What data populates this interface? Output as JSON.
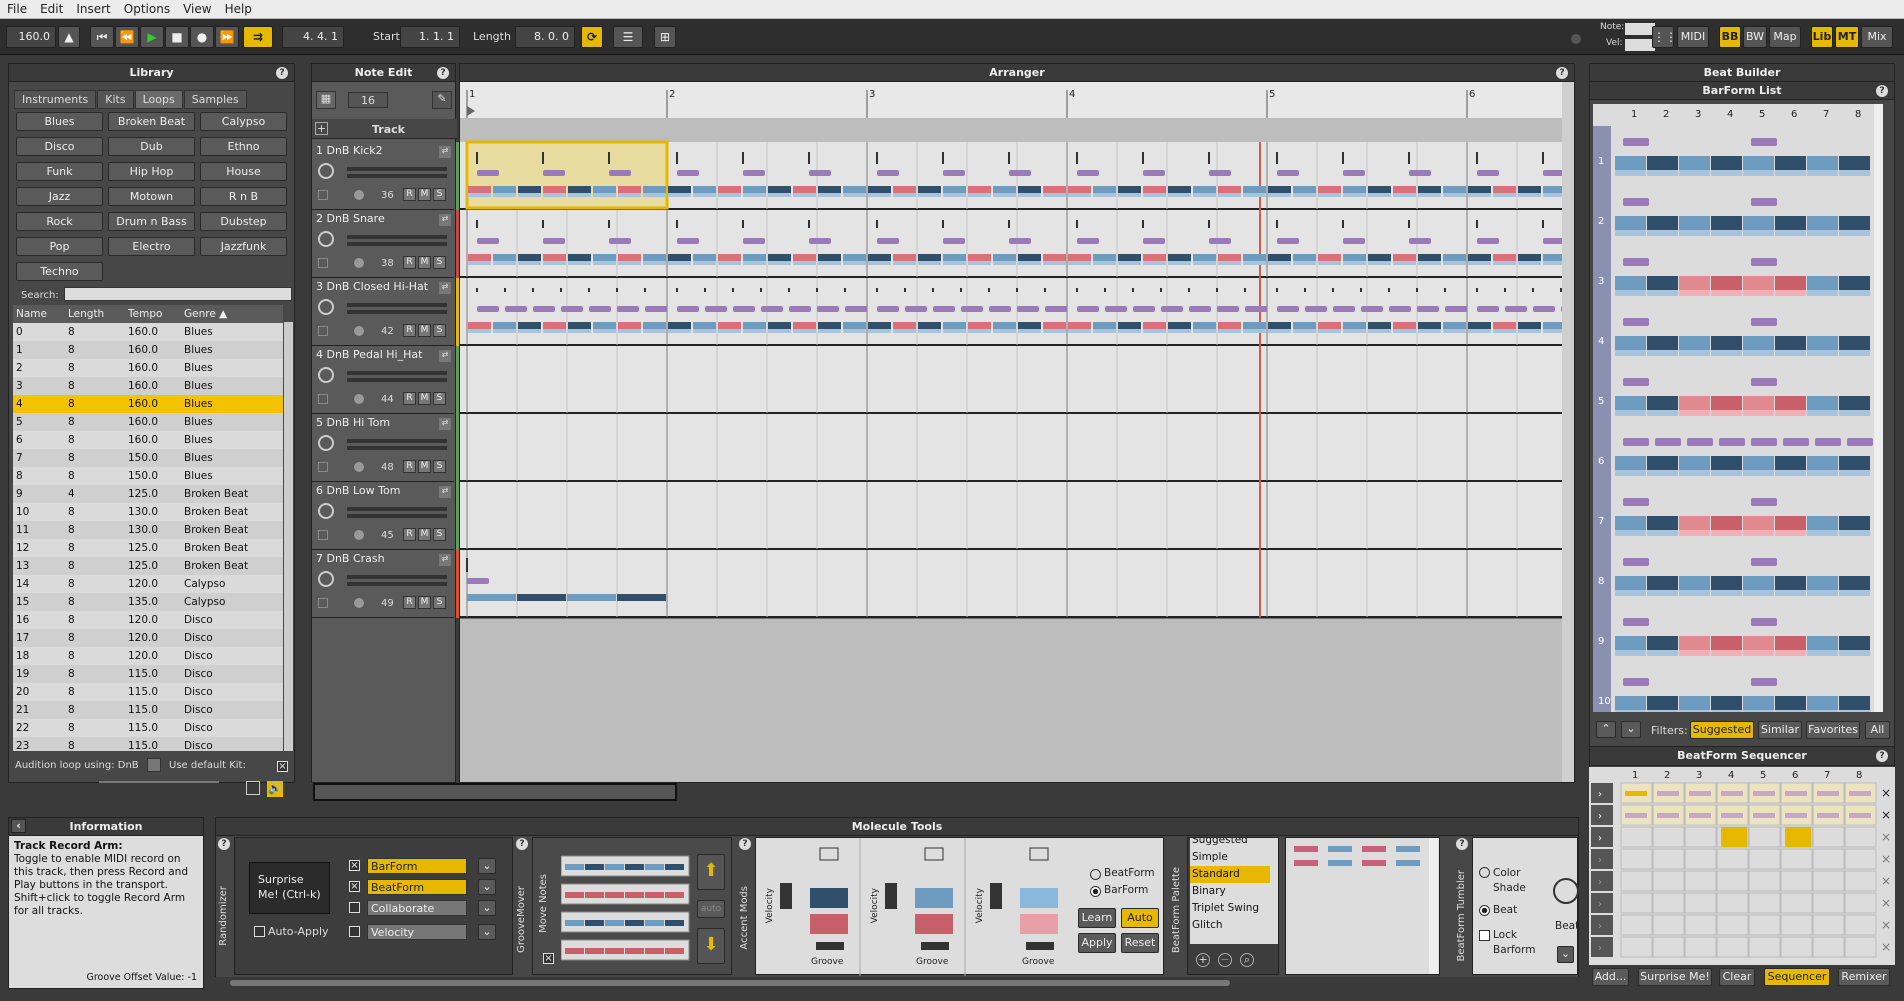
{
  "menu": [
    "File",
    "Edit",
    "Insert",
    "Options",
    "View",
    "Help"
  ],
  "transport": {
    "tempo": "160.0",
    "position": "4. 4. 1",
    "start_label": "Start",
    "start_value": "1. 1. 1",
    "length_label": "Length",
    "length_value": "8. 0. 0",
    "note_label": "Note:",
    "vel_label": "Vel:",
    "midi": "MIDI",
    "toggles": [
      "BB",
      "BW",
      "Map",
      "Lib",
      "MT",
      "Mix"
    ]
  },
  "library": {
    "title": "Library",
    "tabs": [
      "Instruments",
      "Kits",
      "Loops",
      "Samples"
    ],
    "genres": [
      "Blues",
      "Broken Beat",
      "Calypso",
      "Disco",
      "Dub",
      "Ethno",
      "Funk",
      "Hip Hop",
      "House",
      "Jazz",
      "Motown",
      "R n B",
      "Rock",
      "Drum n Bass",
      "Dubstep",
      "Pop",
      "Electro",
      "Jazzfunk",
      "Techno"
    ],
    "search_label": "Search:",
    "columns": [
      "Name",
      "Length",
      "Tempo",
      "Genre ▲"
    ],
    "rows": [
      [
        "0",
        "8",
        "160.0",
        "Blues"
      ],
      [
        "1",
        "8",
        "160.0",
        "Blues"
      ],
      [
        "2",
        "8",
        "160.0",
        "Blues"
      ],
      [
        "3",
        "8",
        "160.0",
        "Blues"
      ],
      [
        "4",
        "8",
        "160.0",
        "Blues"
      ],
      [
        "5",
        "8",
        "160.0",
        "Blues"
      ],
      [
        "6",
        "8",
        "160.0",
        "Blues"
      ],
      [
        "7",
        "8",
        "150.0",
        "Blues"
      ],
      [
        "8",
        "8",
        "150.0",
        "Blues"
      ],
      [
        "9",
        "4",
        "125.0",
        "Broken Beat"
      ],
      [
        "10",
        "8",
        "130.0",
        "Broken Beat"
      ],
      [
        "11",
        "8",
        "130.0",
        "Broken Beat"
      ],
      [
        "12",
        "8",
        "125.0",
        "Broken Beat"
      ],
      [
        "13",
        "8",
        "125.0",
        "Broken Beat"
      ],
      [
        "14",
        "8",
        "120.0",
        "Calypso"
      ],
      [
        "15",
        "8",
        "135.0",
        "Calypso"
      ],
      [
        "16",
        "8",
        "120.0",
        "Disco"
      ],
      [
        "17",
        "8",
        "120.0",
        "Disco"
      ],
      [
        "18",
        "8",
        "120.0",
        "Disco"
      ],
      [
        "19",
        "8",
        "115.0",
        "Disco"
      ],
      [
        "20",
        "8",
        "115.0",
        "Disco"
      ],
      [
        "21",
        "8",
        "115.0",
        "Disco"
      ],
      [
        "22",
        "8",
        "115.0",
        "Disco"
      ],
      [
        "23",
        "8",
        "115.0",
        "Disco"
      ]
    ],
    "audition_label": "Audition loop using: DnB",
    "default_kit_label": "Use default Kit:"
  },
  "noteedit": {
    "title": "Note Edit",
    "grid": "16",
    "track_header": "Track"
  },
  "arranger": {
    "title": "Arranger",
    "bars": [
      "1",
      "2",
      "3",
      "4",
      "5",
      "6"
    ]
  },
  "tracks": [
    {
      "name": "1 DnB Kick2",
      "num": "36"
    },
    {
      "name": "2 DnB Snare",
      "num": "38"
    },
    {
      "name": "3 DnB Closed Hi-Hat",
      "num": "42"
    },
    {
      "name": "4 DnB Pedal Hi_Hat",
      "num": "44"
    },
    {
      "name": "5 DnB Hi Tom",
      "num": "48"
    },
    {
      "name": "6 DnB Low Tom",
      "num": "45"
    },
    {
      "name": "7 DnB Crash",
      "num": "49"
    }
  ],
  "track_btns": [
    "R",
    "M",
    "S"
  ],
  "beatbuilder": {
    "title": "Beat Builder",
    "barform_list": "BarForm List",
    "cols": [
      "1",
      "2",
      "3",
      "4",
      "5",
      "6",
      "7",
      "8"
    ],
    "rows": [
      "1",
      "2",
      "3",
      "4",
      "5",
      "6",
      "7",
      "8",
      "9",
      "10"
    ],
    "filters_label": "Filters:",
    "filters": [
      "Suggested",
      "Similar",
      "Favorites",
      "All"
    ],
    "sequencer_title": "BeatForm Sequencer",
    "bottom": [
      "Add...",
      "Surprise Me!",
      "Clear",
      "Sequencer",
      "Remixer"
    ]
  },
  "info": {
    "title": "Information",
    "heading": "Track Record Arm:",
    "body": "Toggle to enable MIDI record on this track, then press Record and Play buttons in the transport. Shift+click to toggle Record Arm for all tracks.",
    "groove_offset": "Groove Offset Value: -1"
  },
  "molecule": {
    "title": "Molecule Tools",
    "randomizer": "Randomizer",
    "surprise": "Surprise Me! (Ctrl-k)",
    "auto_apply": "Auto-Apply",
    "options": [
      "BarForm",
      "BeatForm",
      "Collaborate",
      "Velocity"
    ],
    "groovemover": "GrooveMover",
    "move_notes": "Move Notes",
    "auto": "auto",
    "accent_mods": "Accent Mods",
    "velocity": "Velocity",
    "groove": "Groove",
    "radio": [
      "BeatForm",
      "BarForm"
    ],
    "learn": "Learn",
    "auto_btn": "Auto",
    "apply": "Apply",
    "reset": "Reset",
    "palette_title": "BeatForm Palette",
    "palette_items": [
      "Suggested",
      "Simple",
      "Standard",
      "Binary",
      "Triplet Swing",
      "Glitch"
    ],
    "tumbler_title": "BeatForm Tumbler",
    "tumbler_opts": [
      "Color Shade",
      "Beat",
      "Lock Barform"
    ],
    "beat": "Beat"
  },
  "colors": {
    "accent": "#e6b800",
    "blue": "#6d9cc0",
    "red": "#c8606a",
    "dark_blue": "#2f4f6a"
  }
}
